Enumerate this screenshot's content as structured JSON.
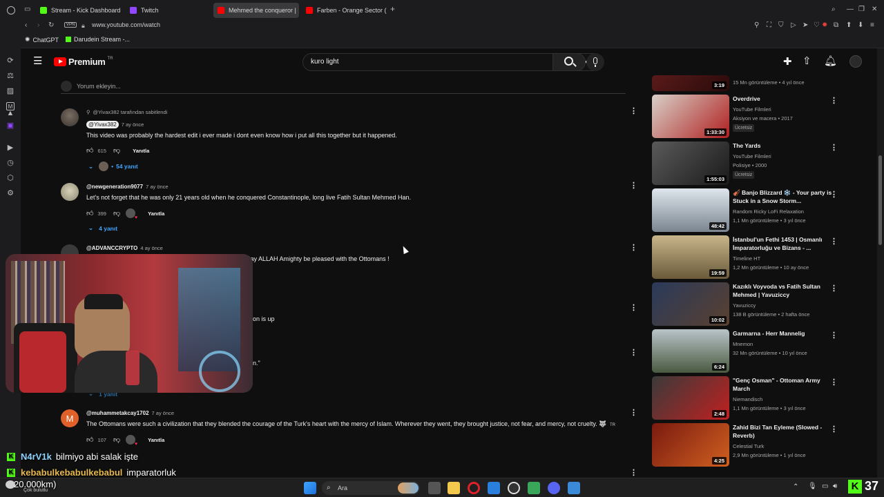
{
  "browser": {
    "tabs": [
      {
        "label": "Stream - Kick Dashboard",
        "color": "#53fc18"
      },
      {
        "label": "Twitch",
        "color": "#9146ff"
      },
      {
        "label": "Mehmed the conqueror |",
        "color": "#ff0000"
      },
      {
        "label": "Farben - Orange Sector (",
        "color": "#ff0000"
      }
    ],
    "add_tab": "+",
    "vpn_label": "VPN",
    "url": "www.youtube.com/watch",
    "bookmarks": [
      {
        "label": "ChatGPT"
      },
      {
        "label": "Darudein Stream -..."
      }
    ]
  },
  "youtube": {
    "logo_text": "Premium",
    "logo_superscript": "TR",
    "search_value": "kuro light"
  },
  "comments": {
    "add_placeholder": "Yorum ekleyin...",
    "items": [
      {
        "pinned_label": "@Yivax382 tarafından sabitlendi",
        "author": "@Yivax382",
        "time": "7 ay önce",
        "text": "This video was probably the hardest edit i ever made i dont even know how i put all this together but it happened.",
        "likes": "615",
        "reply_label": "Yanıtla",
        "replies": "54 yanıt"
      },
      {
        "author": "@newgeneration9077",
        "time": "7 ay önce",
        "text": "Let's not forget that he was only 21 years old when he conquered Constantinople, long live Fatih Sultan Mehmed Han.",
        "likes": "399",
        "reply_label": "Yanıtla",
        "replies": "4 yanıt"
      },
      {
        "author": "@ADVANCCRYPTO",
        "time": "4 ay önce",
        "text": "May ALLAH Amighty be pleased with the Ottomans !"
      },
      {
        "text_fragment": "on is up"
      },
      {
        "text_fragment": "n.\"",
        "replies": "1 yanıt"
      },
      {
        "author": "@muhammetakcay1702",
        "avatar_letter": "M",
        "time": "7 ay önce",
        "text": "The Ottomans were such a civilization that they blended the courage of the Turk's heart with the mercy of Islam. Wherever they went, they brought justice, not fear, and mercy, not cruelty. 🐺",
        "flag_text": "TR",
        "likes": "107",
        "reply_label": "Yanıtla"
      }
    ]
  },
  "recommended": [
    {
      "title": "",
      "channel": "",
      "meta": "15 Mn görüntüleme • 4 yıl önce",
      "duration": "3:19"
    },
    {
      "title": "Overdrive",
      "channel": "YouTube Filmleri",
      "meta": "Aksiyon ve macera • 2017",
      "badge": "Ücretsiz",
      "duration": "1:33:30"
    },
    {
      "title": "The Yards",
      "channel": "YouTube Filmleri",
      "meta": "Polisiye • 2000",
      "badge": "Ücretsiz",
      "duration": "1:55:03"
    },
    {
      "title": "🎻 Banjo Blizzard ❄️ - Your party is Stuck in a Snow Storm...",
      "channel": "Random Ricky LoFi Relaxation",
      "meta": "1,1 Mn görüntüleme • 3 yıl önce",
      "duration": "48:42"
    },
    {
      "title": "İstanbul'un Fethi 1453 | Osmanlı İmparatorluğu ve Bizans - ...",
      "channel": "Timeline HT",
      "meta": "1,2 Mn görüntüleme • 10 ay önce",
      "duration": "19:59"
    },
    {
      "title": "Kazıklı Voyvoda vs Fatih Sultan Mehmed | Yavuziccy",
      "channel": "Yavuziccy",
      "meta": "138 B görüntüleme • 2 hafta önce",
      "duration": "10:02"
    },
    {
      "title": "Garmarna - Herr Mannelig",
      "channel": "Mnemon",
      "meta": "32 Mn görüntüleme • 10 yıl önce",
      "duration": "6:24"
    },
    {
      "title": "\"Genç Osman\" - Ottoman Army March",
      "channel": "Niemandisch",
      "meta": "1,1 Mn görüntüleme • 3 yıl önce",
      "duration": "2:48"
    },
    {
      "title": "Zahid Bizi Tan Eyleme (Slowed - Reverb)",
      "channel": "Celestial Turk",
      "meta": "2,9 Mn görüntüleme • 1 yıl önce",
      "duration": "4:25"
    }
  ],
  "chat": [
    {
      "user": "N4rV1k",
      "message": "bilmiyo abi salak işte",
      "user_color": "#8fd3ff"
    },
    {
      "user": "kebabulkebabulkebabul",
      "message": "imparatorluk",
      "user_color": "#e8b84a"
    }
  ],
  "overlay": {
    "weather": "20.000km)",
    "weather_sub": "Çok bulutlu",
    "viewer_count": "37"
  },
  "taskbar": {
    "search_label": "Ara"
  }
}
